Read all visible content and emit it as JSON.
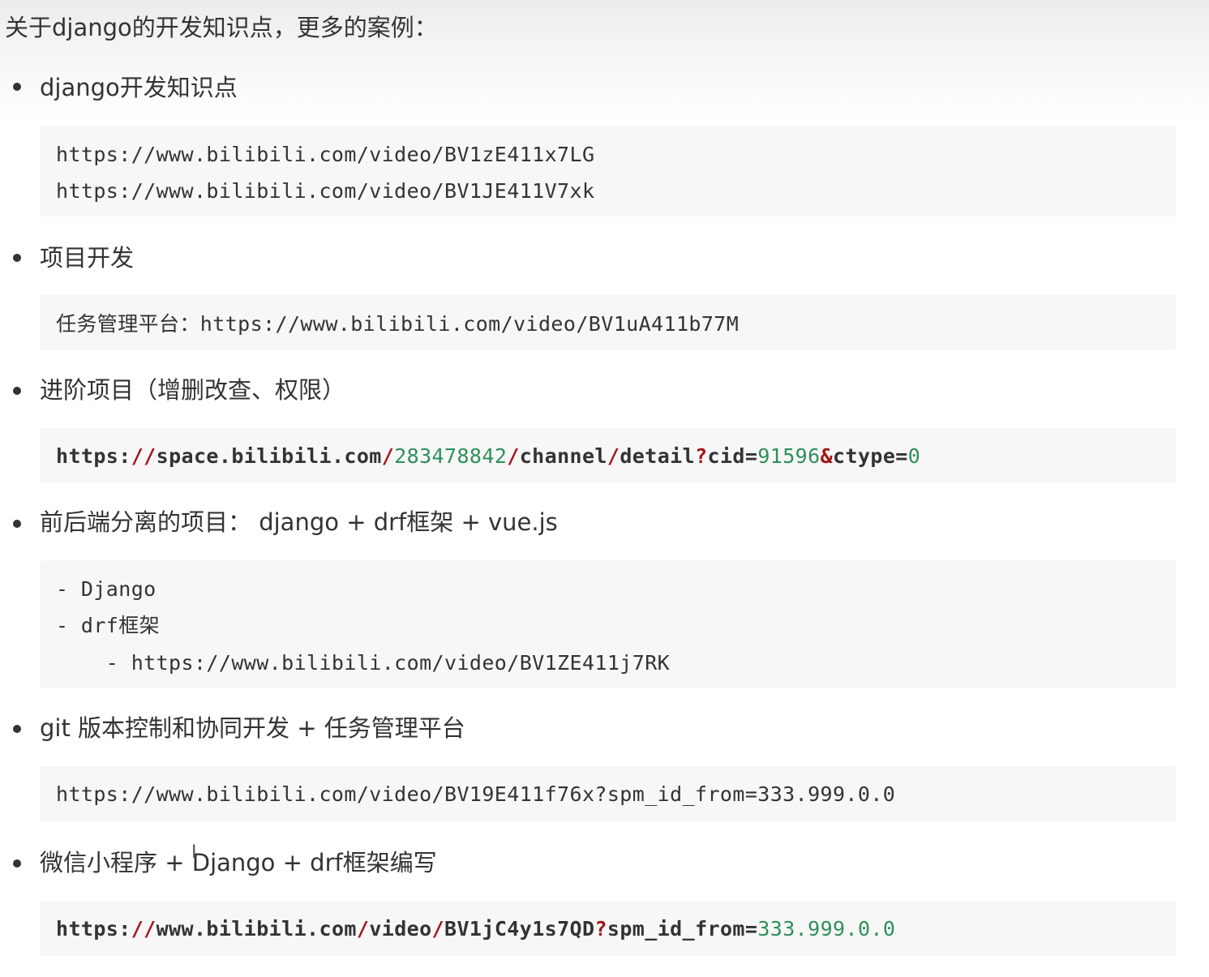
{
  "intro": "关于django的开发知识点，更多的案例：",
  "sections": [
    {
      "title": "django开发知识点",
      "code_lines": [
        "https://www.bilibili.com/video/BV1zE411x7LG",
        "https://www.bilibili.com/video/BV1JE411V7xk"
      ]
    },
    {
      "title": "项目开发",
      "code_lines": [
        "任务管理平台：https://www.bilibili.com/video/BV1uA411b77M"
      ]
    },
    {
      "title": "进阶项目（增删改查、权限）",
      "code_tokens": [
        {
          "t": "https:",
          "c": "plain"
        },
        {
          "t": "//",
          "c": "red"
        },
        {
          "t": "space.bilibili.com",
          "c": "plain"
        },
        {
          "t": "/",
          "c": "red"
        },
        {
          "t": "283478842",
          "c": "green"
        },
        {
          "t": "/",
          "c": "red"
        },
        {
          "t": "channel",
          "c": "plain"
        },
        {
          "t": "/",
          "c": "red"
        },
        {
          "t": "detail",
          "c": "plain"
        },
        {
          "t": "?",
          "c": "red"
        },
        {
          "t": "cid=",
          "c": "plain"
        },
        {
          "t": "91596",
          "c": "green"
        },
        {
          "t": "&",
          "c": "red"
        },
        {
          "t": "ctype=",
          "c": "plain"
        },
        {
          "t": "0",
          "c": "green"
        }
      ]
    },
    {
      "title": "前后端分离的项目： django + drf框架 + vue.js",
      "code_lines": [
        "- Django",
        "- drf框架",
        "    - https://www.bilibili.com/video/BV1ZE411j7RK"
      ]
    },
    {
      "title": "git 版本控制和协同开发 + 任务管理平台",
      "code_lines": [
        "https://www.bilibili.com/video/BV19E411f76x?spm_id_from=333.999.0.0"
      ]
    },
    {
      "title": "微信小程序 + Django + drf框架编写",
      "code_tokens": [
        {
          "t": "https:",
          "c": "plain"
        },
        {
          "t": "//",
          "c": "red"
        },
        {
          "t": "www.bilibili.com",
          "c": "plain"
        },
        {
          "t": "/",
          "c": "red"
        },
        {
          "t": "video",
          "c": "plain"
        },
        {
          "t": "/",
          "c": "red"
        },
        {
          "t": "BV1jC4y1s7QD",
          "c": "plain"
        },
        {
          "t": "?",
          "c": "red"
        },
        {
          "t": "spm_id_from=",
          "c": "plain"
        },
        {
          "t": "333.999.0.0",
          "c": "green"
        }
      ]
    }
  ],
  "colors": {
    "text": "#333333",
    "code_bg": "#f7f7f7",
    "token_red": "#a31515",
    "token_green": "#2f8f5b"
  },
  "icons": {
    "cursor": "text-cursor-icon"
  }
}
